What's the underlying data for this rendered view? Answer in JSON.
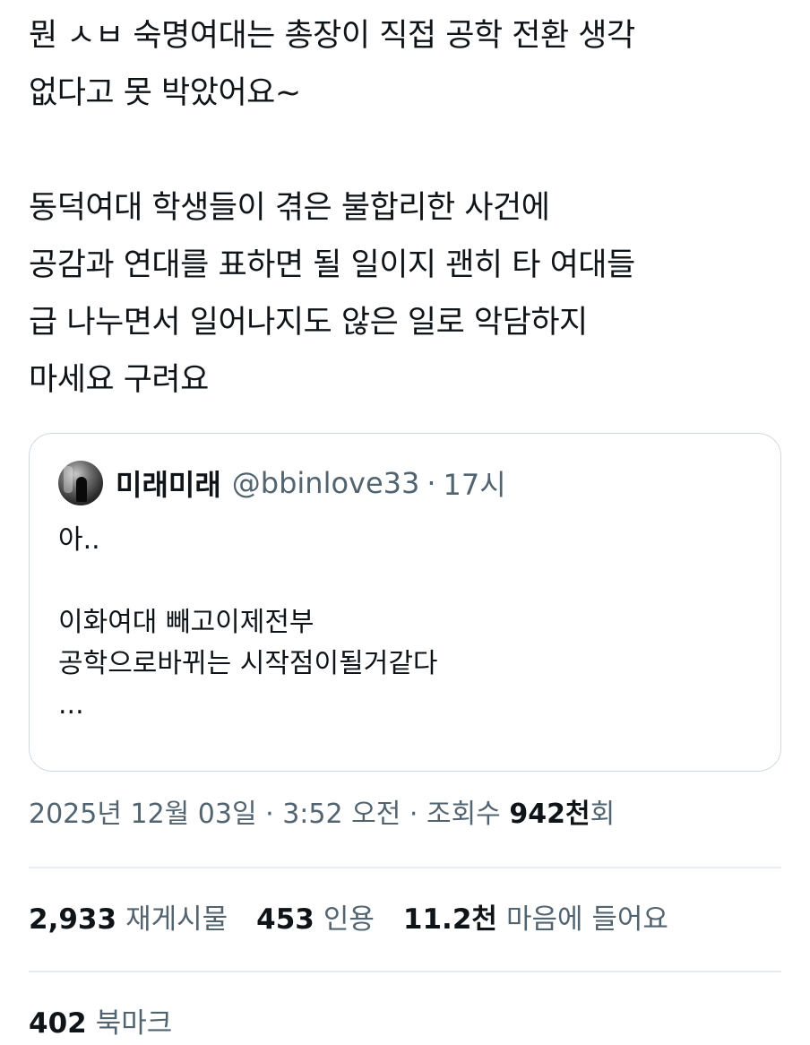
{
  "tweet": {
    "lines": [
      "뭔 ㅅㅂ 숙명여대는 총장이 직접 공학 전환 생각",
      "없다고 못 박았어요~",
      "",
      "동덕여대 학생들이 겪은 불합리한 사건에",
      "공감과 연대를 표하면 될 일이지 괜히 타 여대들",
      "급 나누면서 일어나지도 않은 일로 악담하지",
      "마세요 구려요"
    ]
  },
  "quote": {
    "avatar_icon": "profile-avatar",
    "name": "미래미래",
    "handle": "@bbinlove33",
    "separator": "·",
    "time": "17시",
    "lines": [
      "아..",
      "",
      "이화여대 빼고이제전부",
      "공학으로바뀌는 시작점이될거같다",
      "..."
    ]
  },
  "meta": {
    "date": "2025년 12월 03일",
    "sep1": "·",
    "time": "3:52 오전",
    "sep2": "·",
    "views_label": "조회수",
    "views_num": "942천",
    "views_suffix": "회"
  },
  "stats": {
    "retweets_num": "2,933",
    "retweets_label": "재게시물",
    "quotes_num": "453",
    "quotes_label": "인용",
    "likes_num": "11.2천",
    "likes_label": "마음에 들어요",
    "bookmarks_num": "402",
    "bookmarks_label": "북마크"
  },
  "colors": {
    "text": "#0f1419",
    "secondary": "#536471",
    "border": "#cfd9de",
    "divider": "#e6ecf0"
  }
}
